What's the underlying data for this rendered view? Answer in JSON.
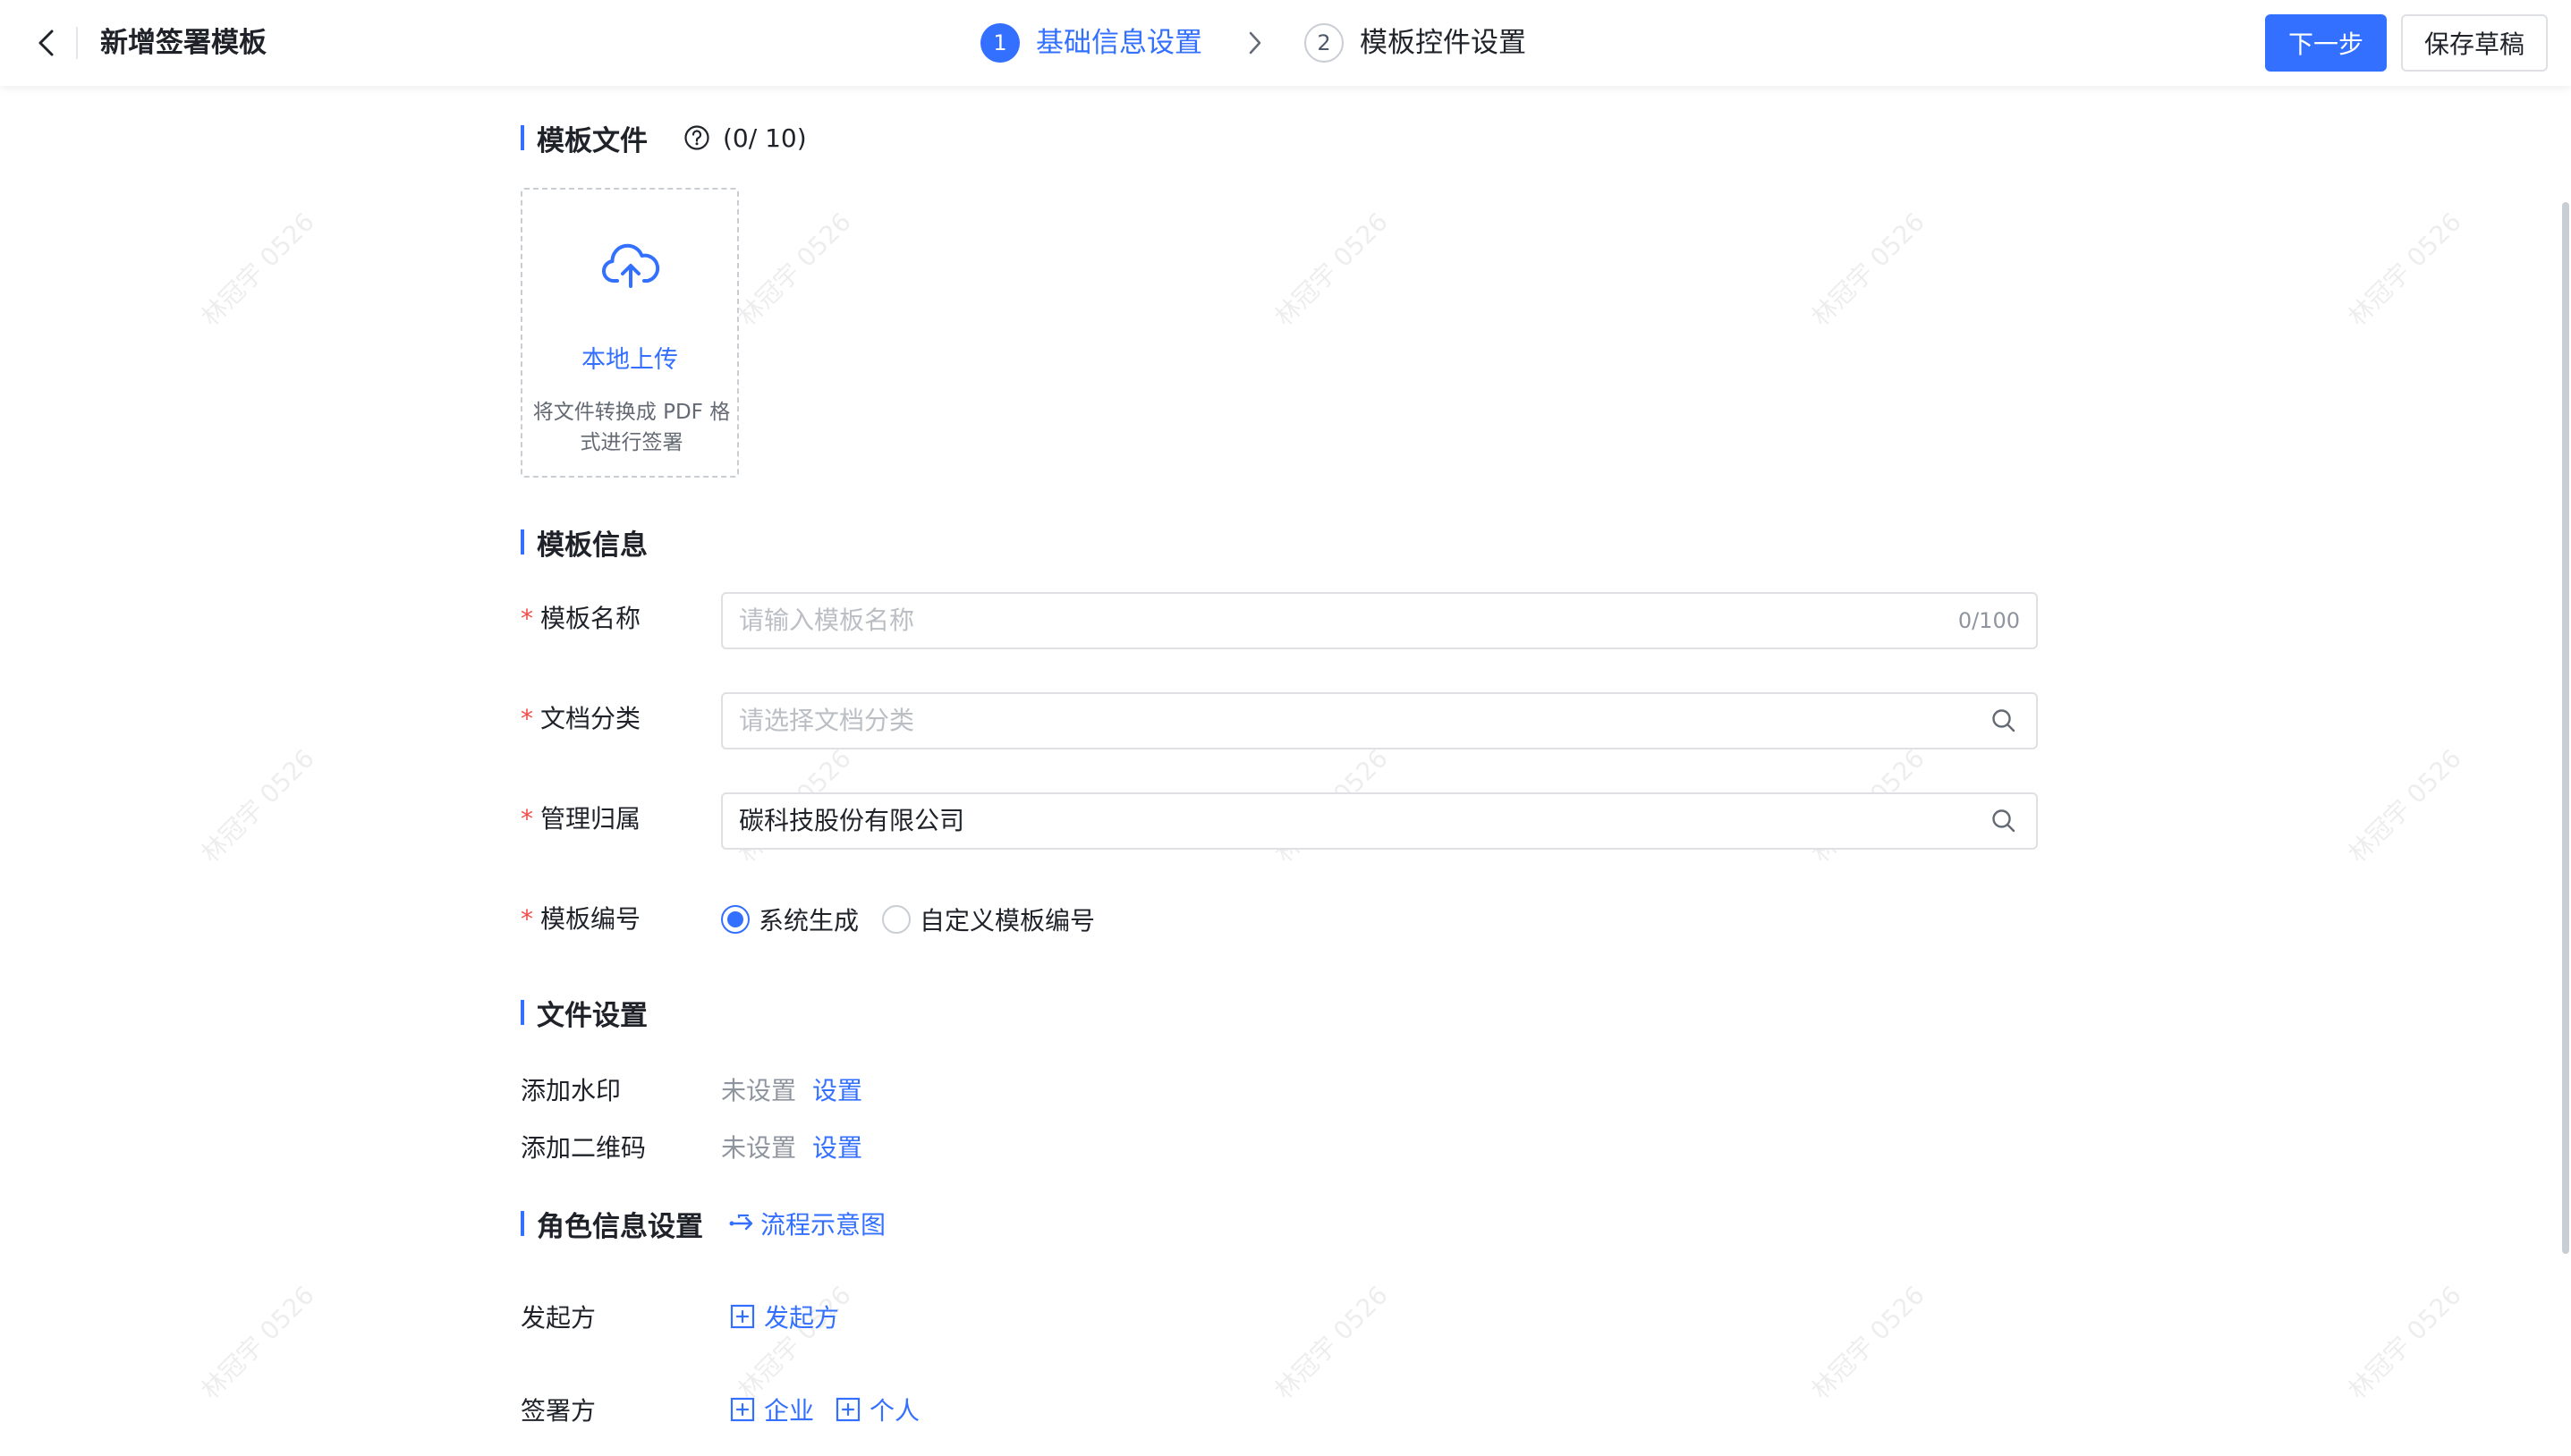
{
  "header": {
    "title": "新增签署模板",
    "steps": [
      {
        "num": "1",
        "label": "基础信息设置"
      },
      {
        "num": "2",
        "label": "模板控件设置"
      }
    ],
    "next_label": "下一步",
    "draft_label": "保存草稿"
  },
  "watermark": "林冠宇 0526",
  "template_file": {
    "title": "模板文件",
    "count": "(0/ 10)",
    "upload_label": "本地上传",
    "upload_hint": "将文件转换成 PDF 格式进行签署"
  },
  "template_info": {
    "title": "模板信息",
    "required_mark": "*",
    "name_label": "模板名称",
    "name_placeholder": "请输入模板名称",
    "name_counter": "0/100",
    "category_label": "文档分类",
    "category_placeholder": "请选择文档分类",
    "owner_label": "管理归属",
    "owner_value": "碳科技股份有限公司",
    "number_label": "模板编号",
    "number_options": [
      "系统生成",
      "自定义模板编号"
    ],
    "number_selected": "系统生成"
  },
  "file_settings": {
    "title": "文件设置",
    "watermark_label": "添加水印",
    "watermark_status": "未设置",
    "watermark_action": "设置",
    "qrcode_label": "添加二维码",
    "qrcode_status": "未设置",
    "qrcode_action": "设置"
  },
  "role_settings": {
    "title": "角色信息设置",
    "flow_link": "流程示意图",
    "initiator_label": "发起方",
    "initiator_add": "发起方",
    "signer_label": "签署方",
    "signer_add_company": "企业",
    "signer_add_person": "个人"
  },
  "colors": {
    "accent": "#3370ff",
    "required": "#f54a45",
    "placeholder": "#bbbfc4",
    "border": "#dee0e3"
  }
}
